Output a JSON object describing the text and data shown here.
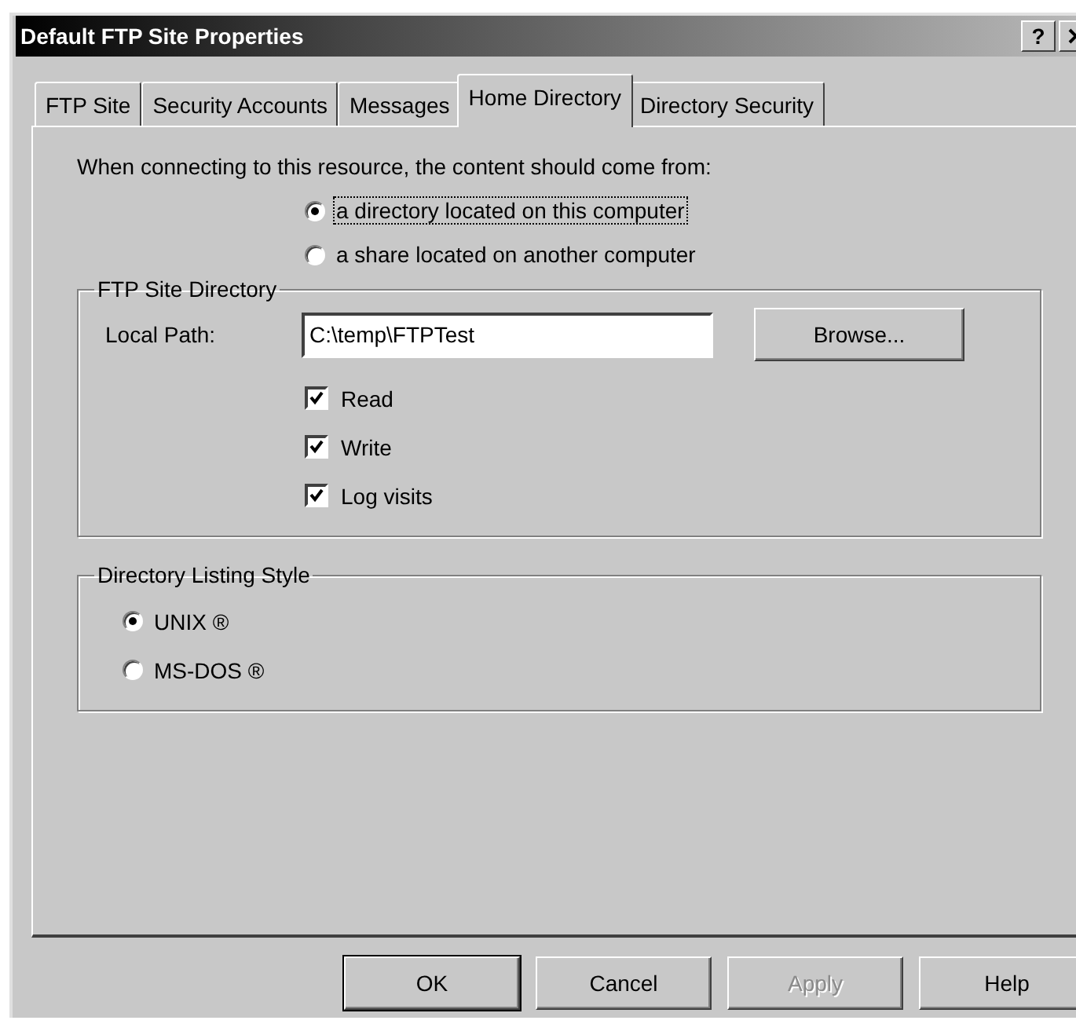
{
  "window": {
    "title": "Default FTP Site Properties",
    "help_button": "?"
  },
  "tabs": [
    {
      "label": "FTP Site",
      "selected": false
    },
    {
      "label": "Security Accounts",
      "selected": false
    },
    {
      "label": "Messages",
      "selected": false
    },
    {
      "label": "Home Directory",
      "selected": true
    },
    {
      "label": "Directory Security",
      "selected": false
    }
  ],
  "source": {
    "prompt": "When connecting to this resource, the content should come from:",
    "options": [
      {
        "label": "a directory located on this computer",
        "selected": true,
        "focused": true
      },
      {
        "label": "a share located on another computer",
        "selected": false,
        "focused": false
      }
    ]
  },
  "ftp_site_directory": {
    "title": "FTP Site Directory",
    "local_path_label": "Local Path:",
    "local_path": "C:\\temp\\FTPTest",
    "browse_button": "Browse...",
    "permissions": [
      {
        "label": "Read",
        "checked": true
      },
      {
        "label": "Write",
        "checked": true
      },
      {
        "label": "Log visits",
        "checked": true
      }
    ]
  },
  "directory_listing_style": {
    "title": "Directory Listing Style",
    "options": [
      {
        "label": "UNIX ®",
        "selected": true
      },
      {
        "label": "MS-DOS ®",
        "selected": false
      }
    ]
  },
  "buttons": [
    {
      "label": "OK",
      "default": true,
      "disabled": false
    },
    {
      "label": "Cancel",
      "default": false,
      "disabled": false
    },
    {
      "label": "Apply",
      "default": false,
      "disabled": true
    },
    {
      "label": "Help",
      "default": false,
      "disabled": false
    }
  ]
}
